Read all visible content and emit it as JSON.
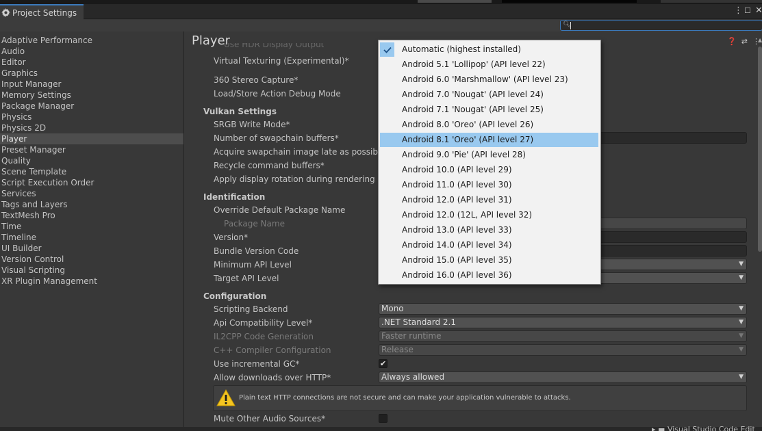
{
  "window": {
    "tab_title": "Project Settings",
    "menu_icon": "kebab-icon",
    "maximize_icon": "maximize-icon",
    "close_icon": "close-icon"
  },
  "search": {
    "value": ""
  },
  "sidebar": {
    "items": [
      "Adaptive Performance",
      "Audio",
      "Editor",
      "Graphics",
      "Input Manager",
      "Memory Settings",
      "Package Manager",
      "Physics",
      "Physics 2D",
      "Player",
      "Preset Manager",
      "Quality",
      "Scene Template",
      "Script Execution Order",
      "Services",
      "Tags and Layers",
      "TextMesh Pro",
      "Time",
      "Timeline",
      "UI Builder",
      "Version Control",
      "Visual Scripting",
      "XR Plugin Management"
    ],
    "selected": "Player"
  },
  "main": {
    "title": "Player",
    "clipped_label": "Use HDR Display Output",
    "rows": {
      "virtual_texturing": "Virtual Texturing (Experimental)*",
      "stereo_capture": "360 Stereo Capture*",
      "load_store": "Load/Store Action Debug Mode",
      "vulkan_header": "Vulkan Settings",
      "srgb_write": "SRGB Write Mode*",
      "swapchain_buffers": "Number of swapchain buffers*",
      "acquire_late": "Acquire swapchain image late as possible*",
      "recycle_cmd": "Recycle command buffers*",
      "display_rotation": "Apply display rotation during rendering",
      "identification_header": "Identification",
      "override_pkg": "Override Default Package Name",
      "package_name": "Package Name",
      "version": "Version*",
      "bundle_code": "Bundle Version Code",
      "min_api": "Minimum API Level",
      "target_api": "Target API Level",
      "configuration_header": "Configuration",
      "scripting_backend": "Scripting Backend",
      "api_compat": "Api Compatibility Level*",
      "il2cpp_gen": "IL2CPP Code Generation",
      "cpp_compiler": "C++ Compiler Configuration",
      "incremental_gc": "Use incremental GC*",
      "allow_http": "Allow downloads over HTTP*",
      "mute_audio": "Mute Other Audio Sources*"
    },
    "values": {
      "scripting_backend": "Mono",
      "api_compat": ".NET Standard 2.1",
      "il2cpp_gen": "Faster runtime",
      "cpp_compiler": "Release",
      "allow_http": "Always allowed",
      "incremental_gc_checked": true,
      "mute_audio_checked": false
    },
    "warning_text": "Plain text HTTP connections are not secure and can make your application vulnerable to attacks."
  },
  "popup": {
    "items": [
      "Automatic (highest installed)",
      "Android 5.1 'Lollipop' (API level 22)",
      "Android 6.0 'Marshmallow' (API level 23)",
      "Android 7.0 'Nougat' (API level 24)",
      "Android 7.1 'Nougat' (API level 25)",
      "Android 8.0 'Oreo' (API level 26)",
      "Android 8.1 'Oreo' (API level 27)",
      "Android 9.0 'Pie' (API level 28)",
      "Android 10.0 (API level 29)",
      "Android 11.0 (API level 30)",
      "Android 12.0 (API level 31)",
      "Android 12.0 (12L, API level 32)",
      "Android 13.0 (API level 33)",
      "Android 14.0 (API level 34)",
      "Android 15.0 (API level 35)",
      "Android 16.0 (API level 36)"
    ],
    "checked": "Automatic (highest installed)",
    "highlighted": "Android 8.1 'Oreo' (API level 27)"
  },
  "bottom": {
    "label": "Visual Studio Code Edit"
  },
  "colors": {
    "accent": "#3a79bb",
    "highlight": "#99c9ef",
    "background": "#383838"
  }
}
